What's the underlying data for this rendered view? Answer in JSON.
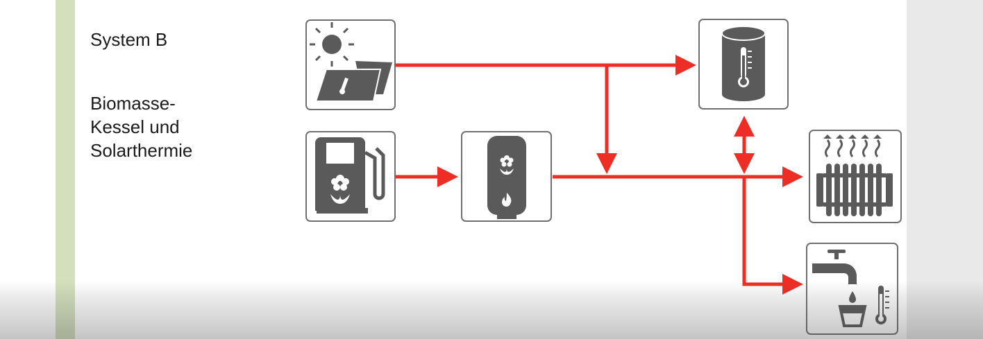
{
  "diagram": {
    "title": "System B",
    "subtitle_lines": [
      "Biomasse-",
      "Kessel und",
      "Solarthermie"
    ]
  },
  "colors": {
    "flow_line": "#ee2e24",
    "icon_fill": "#5a5a5a",
    "box_border": "#6f6f6f",
    "left_border": "#d4e0bd"
  },
  "nodes": [
    {
      "id": "solar-collector",
      "icon": "sun-solar-panel-icon"
    },
    {
      "id": "biomass-fuel",
      "icon": "fuel-pump-flower-icon"
    },
    {
      "id": "biomass-boiler",
      "icon": "boiler-flame-icon"
    },
    {
      "id": "storage-tank",
      "icon": "tank-thermometer-icon"
    },
    {
      "id": "space-heating",
      "icon": "radiator-icon"
    },
    {
      "id": "hot-water",
      "icon": "tap-water-icon"
    }
  ]
}
